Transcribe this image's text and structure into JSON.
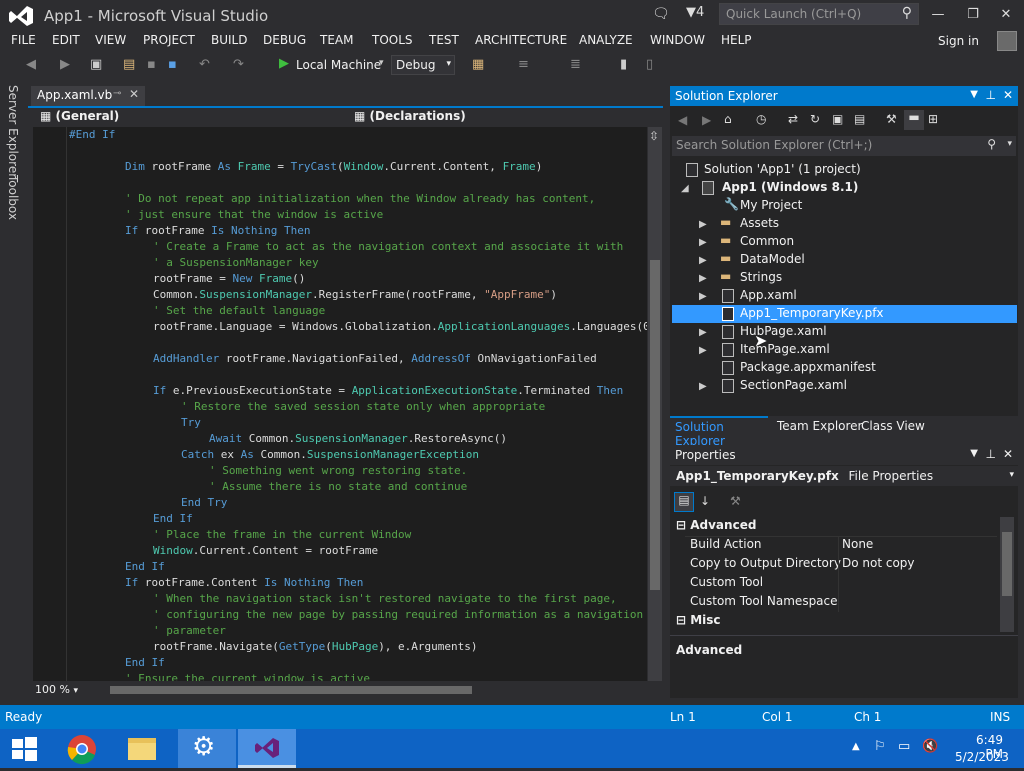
{
  "window": {
    "title": "App1 - Microsoft Visual Studio",
    "notifications_count": "4",
    "quick_launch_placeholder": "Quick Launch (Ctrl+Q)"
  },
  "menu": [
    "FILE",
    "EDIT",
    "VIEW",
    "PROJECT",
    "BUILD",
    "DEBUG",
    "TEAM",
    "TOOLS",
    "TEST",
    "ARCHITECTURE",
    "ANALYZE",
    "WINDOW",
    "HELP"
  ],
  "signin_label": "Sign in",
  "toolbar": {
    "run_target": "Local Machine",
    "configuration": "Debug"
  },
  "left_rail": {
    "server_explorer": "Server Explorer",
    "toolbox": "Toolbox"
  },
  "editor": {
    "tab_label": "App.xaml.vb",
    "nav_left": "(General)",
    "nav_right": "(Declarations)",
    "zoom": "100 %"
  },
  "solution_explorer": {
    "title": "Solution Explorer",
    "search_placeholder": "Search Solution Explorer (Ctrl+;)",
    "solution": "Solution 'App1' (1 project)",
    "project": "App1 (Windows 8.1)",
    "items": [
      "My Project",
      "Assets",
      "Common",
      "DataModel",
      "Strings",
      "App.xaml",
      "App1_TemporaryKey.pfx",
      "HubPage.xaml",
      "ItemPage.xaml",
      "Package.appxmanifest",
      "SectionPage.xaml"
    ],
    "tabs": [
      "Solution Explorer",
      "Team Explorer",
      "Class View"
    ]
  },
  "properties": {
    "title": "Properties",
    "selected_name": "App1_TemporaryKey.pfx",
    "selected_type": "File Properties",
    "category_advanced": "Advanced",
    "rows": [
      {
        "name": "Build Action",
        "value": "None"
      },
      {
        "name": "Copy to Output Directory",
        "value": "Do not copy"
      },
      {
        "name": "Custom Tool",
        "value": ""
      },
      {
        "name": "Custom Tool Namespace",
        "value": ""
      }
    ],
    "category_misc": "Misc",
    "description_title": "Advanced"
  },
  "status": {
    "state": "Ready",
    "ln": "Ln 1",
    "col": "Col 1",
    "ch": "Ch 1",
    "mode": "INS"
  },
  "clock": {
    "time": "6:49 PM",
    "date": "5/2/2023"
  },
  "colors": {
    "accent": "#007acc",
    "selection": "#3399ff",
    "taskbar": "#0e63c4"
  }
}
